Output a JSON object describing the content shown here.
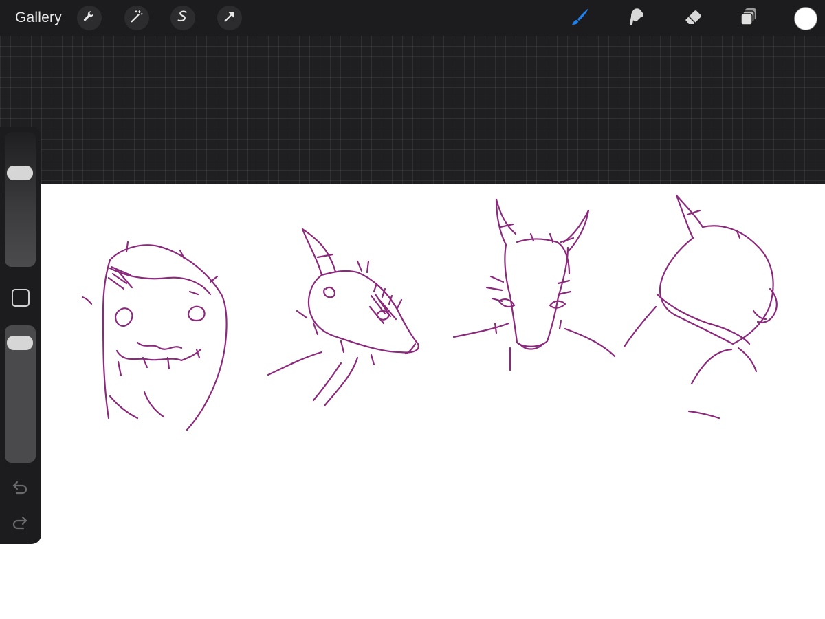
{
  "toolbar": {
    "gallery_label": "Gallery",
    "left_tools": [
      "wrench-icon",
      "magic-wand-icon",
      "selection-icon",
      "transform-icon"
    ],
    "right_tools": [
      "brush-icon",
      "smudge-icon",
      "eraser-icon",
      "layers-icon"
    ],
    "active_tool": "brush-icon",
    "active_color": "#ffffff"
  },
  "sidebar": {
    "brush_size_level": 0.73,
    "brush_opacity_level": 0.93,
    "buttons": [
      "modify-button",
      "undo-button",
      "redo-button"
    ]
  },
  "canvas": {
    "stroke_color": "#8b2a7c",
    "sketch_count": 4
  }
}
